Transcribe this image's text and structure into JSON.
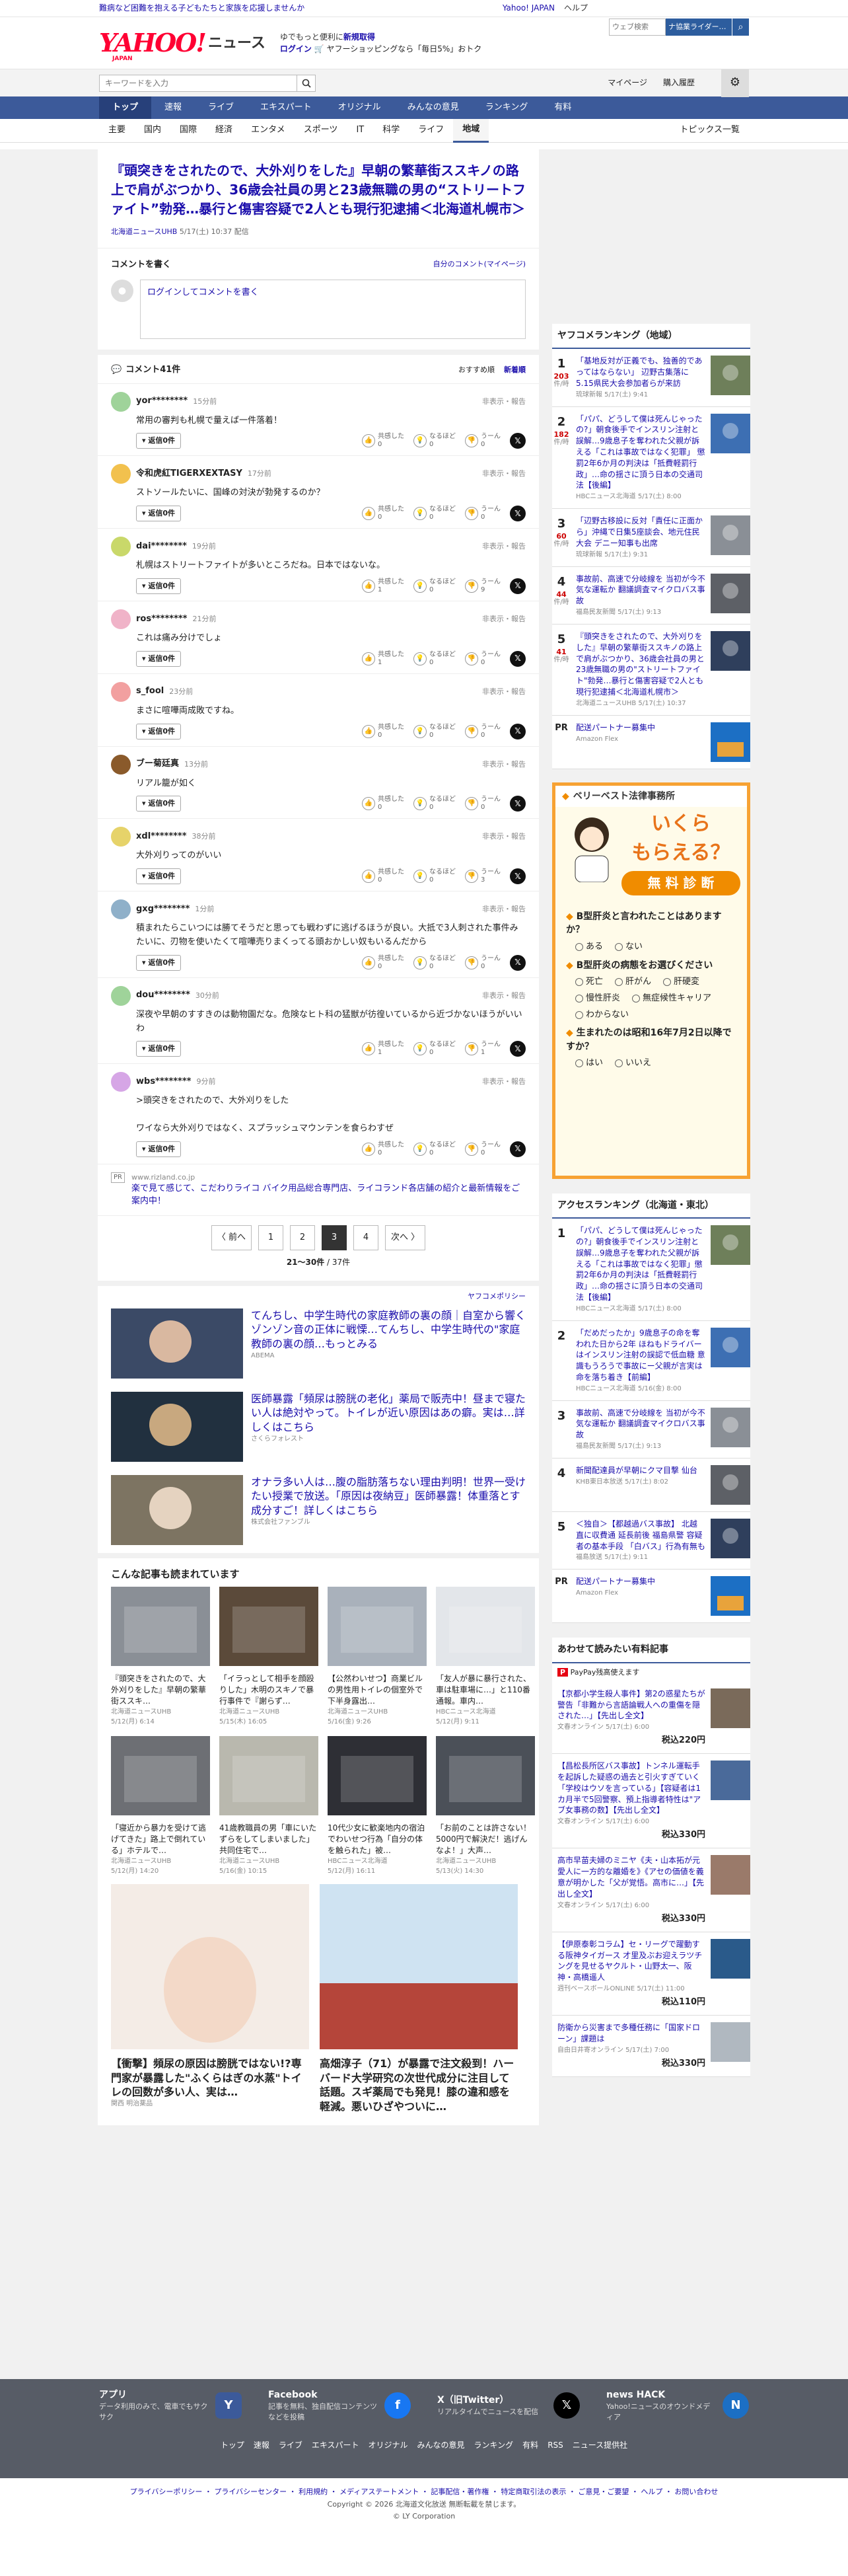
{
  "top_strip": {
    "notice": "難病など困難を抱える子どもたちと家族を応援しませんか",
    "links": [
      "Yahoo! JAPAN",
      "ヘルプ"
    ]
  },
  "header": {
    "logo_main": "YAHOO!",
    "logo_sub": "JAPAN",
    "logo_news": "ニュース",
    "promo_line1_pre": "ゆでもっと便利に",
    "promo_line1_link": "新規取得",
    "promo_line2_link": "ログイン",
    "promo_line2_rest": "🛒 ヤフーショッピングなら「毎日5%」おトク",
    "websearch_placeholder": "ウェブ検索",
    "websearch_btn": "ナ協業ライダー…"
  },
  "search": {
    "placeholder": "キーワードを入力",
    "links": [
      "マイページ",
      "購入履歴"
    ]
  },
  "nav": {
    "items": [
      "トップ",
      "速報",
      "ライブ",
      "エキスパート",
      "オリジナル",
      "みんなの意見",
      "ランキング",
      "有料"
    ],
    "active": 0
  },
  "subnav": {
    "items": [
      "主要",
      "国内",
      "国際",
      "経済",
      "エンタメ",
      "スポーツ",
      "IT",
      "科学",
      "ライフ",
      "地域"
    ],
    "active": 9,
    "right": "トピックス一覧"
  },
  "article": {
    "title": "『頭突きをされたので、大外刈りをした』早朝の繁華街ススキノの路上で肩がぶつかり、36歳会社員の男と23歳無職の男の“ストリートファイト”勃発…暴行と傷害容疑で2人とも現行犯逮捕＜北海道札幌市＞",
    "source": "北海道ニュースUHB",
    "date": "5/17(土) 10:37 配信"
  },
  "comment_form": {
    "title": "コメントを書く",
    "mine": "自分のコメント(マイページ)",
    "login": "ログイン",
    "placeholder_rest": "してコメントを書く"
  },
  "comments_header": {
    "title": "コメント41件",
    "sort_rec": "おすすめ順",
    "sort_new": "新着順"
  },
  "comment_labels": {
    "reply": "返信0件",
    "report": "非表示・報告",
    "agree": "共感した",
    "hmm": "なるほど",
    "uun": "うーん"
  },
  "comments": [
    {
      "user": "yor********",
      "time": "15分前",
      "text": "常用の審判も札幌で量えば一件落着！",
      "agree": "0",
      "hmm": "0",
      "uun": "0",
      "color": "#9fd39a"
    },
    {
      "user": "令和虎紅TIGERXEXTASY",
      "time": "17分前",
      "text": "ストソールたいに、国峰の対決が勃発するのか？",
      "agree": "0",
      "hmm": "0",
      "uun": "0",
      "color": "#f2c14e"
    },
    {
      "user": "dai********",
      "time": "19分前",
      "text": "札幌はストリートファイトが多いところだね。日本ではないな。",
      "agree": "1",
      "hmm": "0",
      "uun": "9",
      "color": "#c9d86a"
    },
    {
      "user": "ros********",
      "time": "21分前",
      "text": "これは痛み分けでしょ",
      "agree": "1",
      "hmm": "0",
      "uun": "0",
      "color": "#f0b3c8"
    },
    {
      "user": "s_fool",
      "time": "23分前",
      "text": "まさに喧嘩両成敗ですね。",
      "agree": "0",
      "hmm": "0",
      "uun": "0",
      "color": "#f2a0a0"
    },
    {
      "user": "ブー菊廷真",
      "time": "13分前",
      "text": "リアル籠が如く",
      "agree": "0",
      "hmm": "0",
      "uun": "0",
      "color": "#8a5a2b"
    },
    {
      "user": "xdl********",
      "time": "38分前",
      "text": "大外刈りってのがいい",
      "agree": "0",
      "hmm": "0",
      "uun": "3",
      "color": "#e6d36a"
    },
    {
      "user": "gxg********",
      "time": "1分前",
      "text": "積まれたらこいつには勝てそうだと思っても戦わずに逃げるほうが良い。大抵で3人刺された事件みたいに、刃物を使いたくて喧嘩売りまくってる頭おかしい奴もいるんだから",
      "agree": "0",
      "hmm": "0",
      "uun": "0",
      "color": "#8fb0c9"
    },
    {
      "user": "dou********",
      "time": "30分前",
      "text": "深夜や早朝のすすきのは動物園だな。危険なヒト科の猛獣が彷徨いているから近づかないほうがいいわ",
      "agree": "1",
      "hmm": "0",
      "uun": "1",
      "color": "#9fd39a"
    },
    {
      "user": "wbs********",
      "time": "9分前",
      "text": ">頭突きをされたので、大外刈りをした\n\nワイなら大外刈りではなく、スプラッシュマウンテンを食らわすぜ",
      "agree": "0",
      "hmm": "0",
      "uun": "0",
      "color": "#d6a6e6"
    }
  ],
  "pr_comment": {
    "tag": "PR",
    "url": "www.rizland.co.jp",
    "text": "楽で見て感じて、こだわりライコ バイク用品総合専門店、ライコランド各店舗の紹介と最新情報をご案内中！"
  },
  "pager": {
    "prev": "〈 前へ",
    "pages": [
      "1",
      "2",
      "3",
      "4"
    ],
    "active": 2,
    "next": "次へ 〉",
    "count": "21〜30件",
    "total": " / 37件"
  },
  "yahoo_policy": "ヤフコメポリシー",
  "ads": [
    {
      "text": "てんちし、中学生時代の家庭教師の裏の顔｜自室から響くゾンゾン音の正体に戦慄…てんちし、中学生時代の\"家庭教師の裏の顔…もっとみる",
      "src": "ABEMA"
    },
    {
      "text": "医師暴露「頻尿は膀胱の老化」薬局で販売中！昼まで寝たい人は絶対やって。トイレが近い原因はあの癖。実は…詳しくはこちら",
      "src": "さくらフォレスト"
    },
    {
      "text": "オナラ多い人は…腹の脂肪落ちない理由判明！世界一受けたい授業で放送。「原因は夜納豆」医師暴露！体重落とす成分すご！詳しくはこちら",
      "src": "株式会社ファンブル"
    }
  ],
  "recommend": {
    "title": "こんな記事も読まれています",
    "items": [
      {
        "t": "『頭突きをされたので、大外刈りをした』早朝の繁華街ススキ…",
        "s": "北海道ニュースUHB",
        "d": "5/12(月) 6:14"
      },
      {
        "t": "「イラっとして相手を顔殴りした」木明のスキノで暴行事件で『謝らず…",
        "s": "北海道ニュースUHB",
        "d": "5/15(木) 16:05"
      },
      {
        "t": "【公然わいせつ】商業ビルの男性用トイレの個室外で下半身露出…",
        "s": "北海道ニュースUHB",
        "d": "5/16(金) 9:26"
      },
      {
        "t": "「友人が暴に暴行された、車は駐車場に…」と110番通報。車内…",
        "s": "HBCニュース北海道",
        "d": "5/12(月) 9:11"
      },
      {
        "t": "「寝近から暴力を受けて逃げてきた」路上で倒れている」ホテルで…",
        "s": "北海道ニュースUHB",
        "d": "5/12(月) 14:20"
      },
      {
        "t": "41歳教職員の男「車にいたずらをしてしまいました」共同住宅で…",
        "s": "北海道ニュースUHB",
        "d": "5/16(金) 10:15"
      },
      {
        "t": "10代少女に歓楽地内の宿泊でわいせつ行為「自分の体を触られた」被…",
        "s": "HBCニュース北海道",
        "d": "5/12(月) 16:11"
      },
      {
        "t": "「お前のことは許さない！5000円で解決だ！逃げんなよ！」大声…",
        "s": "北海道ニュースUHB",
        "d": "5/13(火) 14:30"
      }
    ]
  },
  "big_ads": [
    {
      "t": "【衝撃】頻尿の原因は膀胱ではない!?専門家が暴露した\"ふくらはぎの水蒸\"トイレの回数が多い人、実は…",
      "src": "関西 明治薬品"
    },
    {
      "t": "高畑淳子（71）が暴露で注文殺到！ハーバード大学研究の次世代成分に注目して話題。スギ薬局でも発見！膝の違和感を軽減。悪いひざやついに…",
      "src": ""
    }
  ],
  "side": {
    "ranking_title": "ヤフコメランキング（地域）",
    "ranking": [
      {
        "n": "1",
        "c": "203",
        "unit": "件/時",
        "t": "「基地反対が正義でも、独善的であってはならない」 辺野古集落に5.15県民大会参加者らが来訪",
        "s": "琉球新報 5/17(土) 9:41"
      },
      {
        "n": "2",
        "c": "182",
        "unit": "件/時",
        "t": "「パパ、どうして僕は死んじゃったの?」朝食後手でインスリン注射と誤解…9歳息子を奪われた父親が訴える「これは事故ではなく犯罪」 懲罰2年6か月の判決は「抵費軽罰行政」…命の揺さに頂う日本の交通司法【後編】",
        "s": "HBCニュース北海道 5/17(土) 8:00"
      },
      {
        "n": "3",
        "c": "60",
        "unit": "件/時",
        "t": "「辺野古移設に反対「責任に正面から」沖縄で日集5座談会、地元住民大会 デニー知事も出席",
        "s": "琉球新報 5/17(土) 9:31"
      },
      {
        "n": "4",
        "c": "44",
        "unit": "件/時",
        "t": "事故前、高速で分岐線を 当初が今不気な運転か 翻議調査マイクロバス事故",
        "s": "福島民友新聞 5/17(土) 9:13"
      },
      {
        "n": "5",
        "c": "41",
        "unit": "件/時",
        "t": "『頭突きをされたので、大外刈りをした』早朝の繁華街ススキノの路上で肩がぶつかり、36歳会社員の男と23歳無職の男の\"ストリートファイト\"勃発…暴行と傷害容疑で2人とも現行犯逮捕＜北海道札幌市＞",
        "s": "北海道ニュースUHB 5/17(土) 10:37"
      }
    ],
    "pr1": {
      "t": "配送パートナー募集中",
      "s": "Amazon Flex"
    },
    "ad": {
      "brand": "ベリーベスト法律事務所",
      "catch1": "いくら",
      "catch2": "もらえる？",
      "btn": "無 料 診 断",
      "q1": "B型肝炎と言われたことはありますか？",
      "q1o": [
        "ある",
        "ない"
      ],
      "q2": "B型肝炎の病態をお選びください",
      "q2o": [
        "死亡",
        "肝がん",
        "肝硬変",
        "慢性肝炎",
        "無症候性キャリア",
        "わからない"
      ],
      "q3": "生まれたのは昭和16年7月2日以降ですか？",
      "q3o": [
        "はい",
        "いいえ"
      ]
    },
    "access_title": "アクセスランキング（北海道・東北）",
    "access": [
      {
        "n": "1",
        "t": "「パパ、どうして僕は死んじゃったの?」朝食後手でインスリン注射と誤解…9歳息子を奪われた父親が訴える「これは事故ではなく犯罪」懲罰2年6か月の判決は「抵費軽罰行政」…命の揺さに頂う日本の交通司法【後編】",
        "s": "HBCニュース北海道 5/17(土) 8:00"
      },
      {
        "n": "2",
        "t": "「だめだったか」9歳息子の命を奪われた日から2年 ほねもドライバーはインスリン注射の誤認で低血糖 意識もうろうで事故にー父親が言実は命を落ち着き【前編】",
        "s": "HBCニュース北海道 5/16(金) 8:00"
      },
      {
        "n": "3",
        "t": "事故前、高速で分岐線を 当初が今不気な運転か 翻議調査マイクロバス事故",
        "s": "福島民友新聞 5/17(土) 9:13"
      },
      {
        "n": "4",
        "t": "新聞配達員が早朝にクマ目撃 仙台",
        "s": "KHB東日本放送 5/17(土) 8:02"
      },
      {
        "n": "5",
        "t": "＜独自＞【都越過バス事故】 北越 直に収費通 延長前後 福島県警 容疑者の基本手段 「白バス」行為有無も",
        "s": "福島放送 5/17(土) 9:11"
      }
    ],
    "pr2": {
      "t": "配送パートナー募集中",
      "s": "Amazon Flex"
    },
    "paid_title": "あわせて読みたい有料記事",
    "paid_badge": "PayPay残高使えます",
    "paid": [
      {
        "t": "【京都小学生殺人事件】第2の惑星たちが警告「非難から言語論戦人への重傷を隠された…」【先出し全文】",
        "s": "文春オンライン 5/17(土) 6:00",
        "p": "税込220円"
      },
      {
        "t": "【昌松長所区バス事故】トンネル運転手を起訴した疑惑の過去と引火すぎていく「学校はウソを言っている」【容疑者は1カ月半で5回警察、預上指導者特性は\"アブ女事務の数】【先出し全文】",
        "s": "文春オンライン 5/17(土) 6:00",
        "p": "税込330円"
      },
      {
        "t": "高市早苗夫婦のミニヤ《夫・山本拓が元愛人に一方的な離婚を》《アセの価値を義意が明かした「父が覚悟。高市に…」【先出し全文】",
        "s": "文春オンライン 5/17(土) 6:00",
        "p": "税込330円"
      },
      {
        "t": "【伊原泰彰コラム】セ・リーグで躍動する阪神タイガース 才里及ぶお迎えラツチングを見せるヤクルト・山野太一、阪神・高橋遥人",
        "s": "週刊ベースボールONLINE 5/17(土) 11:00",
        "p": "税込110円"
      },
      {
        "t": "防衛から災害まで多種任務に「国家ドローン」課題は",
        "s": "自由日井寄オンライン 5/17(土) 7:00",
        "p": "税込330円"
      }
    ]
  },
  "footer": {
    "apps": [
      {
        "name": "アプリ",
        "desc": "データ利用のみで、電車でもサクサク",
        "icon": "yahoo-app-icon"
      },
      {
        "name": "Facebook",
        "desc": "記事を無料、独自配信コンテンツなどを投稿",
        "icon": "facebook-icon"
      },
      {
        "name": "X（旧Twitter）",
        "desc": "リアルタイムでニュースを配信",
        "icon": "x-icon"
      },
      {
        "name": "news HACK",
        "desc": "Yahoo!ニュースのオウンドメディア",
        "icon": "newshack-icon"
      }
    ],
    "links": [
      "トップ",
      "速報",
      "ライブ",
      "エキスパート",
      "オリジナル",
      "みんなの意見",
      "ランキング",
      "有料",
      "RSS",
      "ニュース提供社"
    ],
    "legal": "プライバシーポリシー ・ プライバシーセンター ・ 利用規約 ・ メディアステートメント ・ 記事配信・著作権 ・ 特定商取引法の表示 ・ ご意見・ご要望 ・ ヘルプ ・ お問い合わせ",
    "copy1": "Copyright © 2026 北海道文化放送 無断転載を禁じます。",
    "copy2": "© LY Corporation"
  },
  "colors": {
    "brand_red": "#ff0033",
    "nav_blue": "#3c5a9a",
    "link": "#1a0dab"
  }
}
